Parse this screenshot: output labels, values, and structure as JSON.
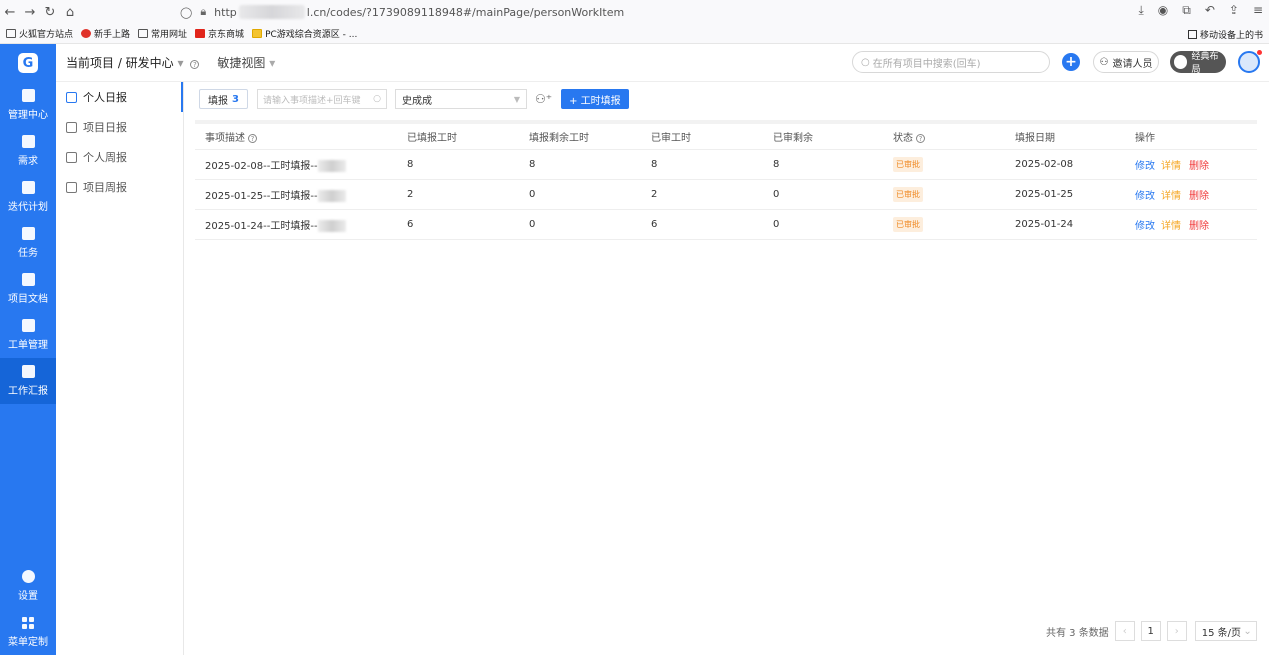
{
  "browser": {
    "url_prefix": "http",
    "url_suffix": "l.cn/codes/?1739089118948#/mainPage/personWorkItem",
    "bookmarks": [
      "火狐官方站点",
      "新手上路",
      "常用网址",
      "京东商城",
      "PC游戏综合资源区 - ..."
    ],
    "mobile_bookmarks": "移动设备上的书"
  },
  "leftnav": {
    "items": [
      {
        "label": "管理中心",
        "icon": "monitor-icon"
      },
      {
        "label": "需求",
        "icon": "document-icon"
      },
      {
        "label": "迭代计划",
        "icon": "layers-icon"
      },
      {
        "label": "任务",
        "icon": "clipboard-icon"
      },
      {
        "label": "项目文档",
        "icon": "file-icon"
      },
      {
        "label": "工单管理",
        "icon": "ticket-icon"
      },
      {
        "label": "工作汇报",
        "icon": "mail-icon"
      }
    ],
    "bottom": [
      {
        "label": "设置",
        "icon": "gear-icon"
      },
      {
        "label": "菜单定制",
        "icon": "grid-icon"
      }
    ]
  },
  "header": {
    "project": "当前项目 / 研发中心",
    "view": "敏捷视图",
    "search_placeholder": "在所有项目中搜索(回车)",
    "invite": "邀请人员",
    "layout": "经典布局"
  },
  "submenu": [
    "个人日报",
    "项目日报",
    "个人周报",
    "项目周报"
  ],
  "toolbar": {
    "tab_label": "填报",
    "tab_count": "3",
    "search_placeholder": "请输入事项描述+回车键",
    "person": "史成成",
    "add_button": "+ 工时填报"
  },
  "table": {
    "headers": [
      "事项描述",
      "已填报工时",
      "填报剩余工时",
      "已审工时",
      "已审剩余",
      "状态",
      "填报日期",
      "操作"
    ],
    "rows": [
      {
        "desc": "2025-02-08--工时填报--",
        "filled": "8",
        "remain": "8",
        "reviewed": "8",
        "reviewed_remain": "8",
        "status": "已审批",
        "date": "2025-02-08"
      },
      {
        "desc": "2025-01-25--工时填报--",
        "filled": "2",
        "remain": "0",
        "reviewed": "2",
        "reviewed_remain": "0",
        "status": "已审批",
        "date": "2025-01-25"
      },
      {
        "desc": "2025-01-24--工时填报--",
        "filled": "6",
        "remain": "0",
        "reviewed": "6",
        "reviewed_remain": "0",
        "status": "已审批",
        "date": "2025-01-24"
      }
    ],
    "ops": {
      "edit": "修改",
      "detail": "详情",
      "delete": "删除"
    }
  },
  "pager": {
    "total": "共有 3 条数据",
    "page": "1",
    "size": "15 条/页"
  },
  "colors": {
    "accent": "#2878f0",
    "status": "#f08a24",
    "danger": "#f03a3a"
  }
}
